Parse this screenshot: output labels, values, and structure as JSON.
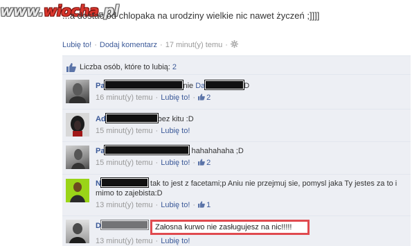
{
  "watermark": {
    "prefix": "www.",
    "accent": "wiocha",
    "suffix": ".pl"
  },
  "post": {
    "text": "...a dostac od chlopaka na urodziny wielkie nic nawet życzeń ;]]]]"
  },
  "actions": {
    "like": "Lubię to!",
    "comment": "Dodaj komentarz",
    "time": "17 minut(y) temu",
    "gear_icon": "gear-icon"
  },
  "likes": {
    "label": "Liczba osób, które to lubią:",
    "count": "2"
  },
  "comments": [
    {
      "author": "Pa",
      "text_prefix": "nie ",
      "mention": "Da",
      "text_suffix": "D",
      "time": "16 minut(y) temu",
      "like": "Lubię to!",
      "likes": "2"
    },
    {
      "author": "Ad",
      "text_suffix": "bez kitu :D",
      "time": "15 minut(y) temu",
      "like": "Lubię to!"
    },
    {
      "author": "Pa",
      "text_suffix": "hahahahaha ;D",
      "time": "15 minut(y) temu",
      "like": "Lubię to!",
      "likes": "2"
    },
    {
      "author": "N",
      "text_suffix": " tak to jest z facetami;p Aniu nie przejmuj sie, pomysl jaka Ty jestes za to i mimo to zajebista:D",
      "time": "13 minut(y) temu",
      "like": "Lubię to!",
      "likes": "1"
    },
    {
      "author": "D",
      "text_suffix": "Załosna kurwo nie zasługujesz na nic!!!!!",
      "time": "13 minut(y) temu",
      "like": "Lubię to!"
    }
  ]
}
